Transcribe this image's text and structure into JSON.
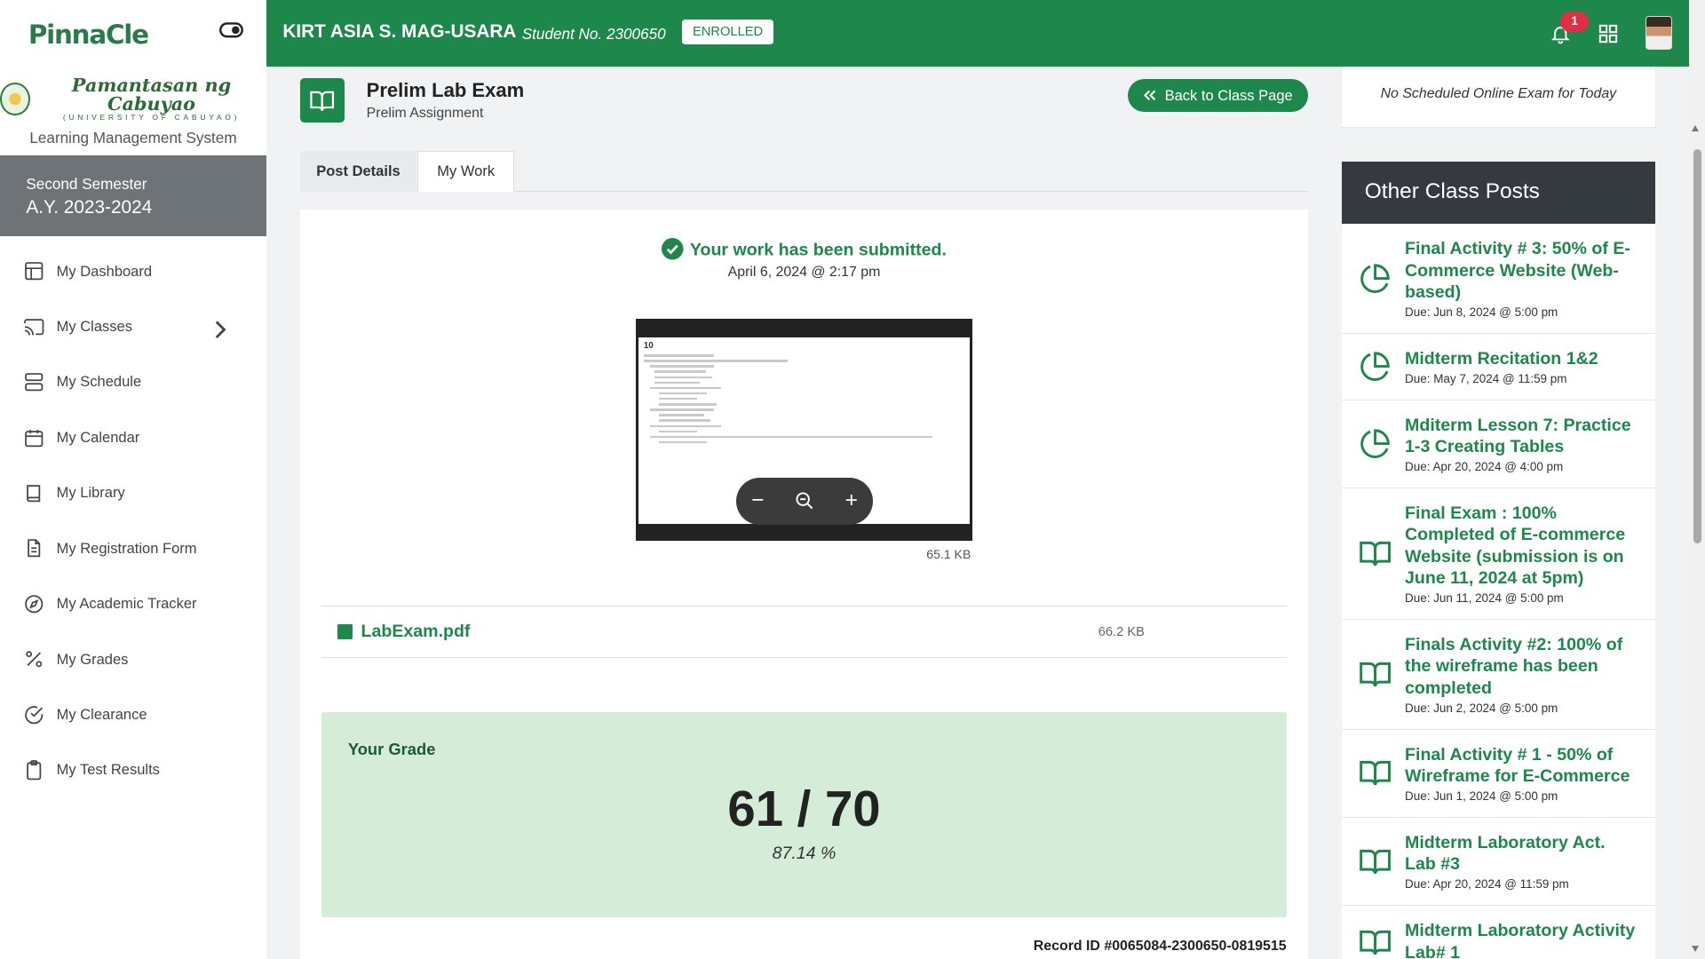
{
  "brand": {
    "logo": "PinnaCle",
    "university_name": "Pamantasan ng Cabuyao",
    "university_sub": "(UNIVERSITY OF CABUYAO)",
    "system_name": "Learning Management System"
  },
  "semester": {
    "term": "Second Semester",
    "year": "A.Y. 2023-2024"
  },
  "nav": [
    {
      "label": "My Dashboard",
      "icon": "dashboard-icon"
    },
    {
      "label": "My Classes",
      "icon": "cast-icon"
    },
    {
      "label": "My Schedule",
      "icon": "server-icon"
    },
    {
      "label": "My Calendar",
      "icon": "calendar-icon"
    },
    {
      "label": "My Library",
      "icon": "book-icon"
    },
    {
      "label": "My Registration Form",
      "icon": "document-icon"
    },
    {
      "label": "My Academic Tracker",
      "icon": "compass-icon"
    },
    {
      "label": "My Grades",
      "icon": "percent-icon"
    },
    {
      "label": "My Clearance",
      "icon": "check-circle-icon"
    },
    {
      "label": "My Test Results",
      "icon": "clipboard-icon"
    }
  ],
  "topbar": {
    "student_name": "KIRT ASIA S. MAG-USARA",
    "student_no": "Student No. 2300650",
    "status": "ENROLLED",
    "notification_count": "1"
  },
  "post": {
    "title": "Prelim Lab Exam",
    "subtitle": "Prelim Assignment",
    "back_label": "Back to Class Page"
  },
  "tabs": [
    "Post Details",
    "My Work"
  ],
  "submission": {
    "message": "Your work has been submitted.",
    "date": "April 6, 2024 @ 2:17 pm",
    "preview_size": "65.1 KB",
    "preview_page_number": "10",
    "file_name": "LabExam.pdf",
    "file_size": "66.2 KB"
  },
  "grade": {
    "label": "Your Grade",
    "score": "61 / 70",
    "percent": "87.14 %",
    "record_id": "Record ID #0065084-2300650-0819515"
  },
  "right": {
    "no_exam": "No Scheduled Online Exam for Today",
    "other_posts_title": "Other Class Posts",
    "posts": [
      {
        "title": "Final Activity # 3: 50% of E-Commerce Website (Web-based)",
        "due": "Due: Jun 8, 2024 @ 5:00 pm",
        "icon": "pie-chart-icon"
      },
      {
        "title": "Midterm Recitation 1&2",
        "due": "Due: May 7, 2024 @ 11:59 pm",
        "icon": "pie-chart-icon"
      },
      {
        "title": "Mditerm Lesson 7: Practice 1-3 Creating Tables",
        "due": "Due: Apr 20, 2024 @ 4:00 pm",
        "icon": "pie-chart-icon"
      },
      {
        "title": "Final Exam : 100% Completed of E-commerce Website (submission is on June 11, 2024 at 5pm)",
        "due": "Due: Jun 11, 2024 @ 5:00 pm",
        "icon": "book-open-icon"
      },
      {
        "title": "Finals Activity #2: 100% of the wireframe has been completed",
        "due": "Due: Jun 2, 2024 @ 5:00 pm",
        "icon": "book-open-icon"
      },
      {
        "title": "Final Activity # 1 - 50% of Wireframe for E-Commerce",
        "due": "Due: Jun 1, 2024 @ 5:00 pm",
        "icon": "book-open-icon"
      },
      {
        "title": "Midterm Laboratory Act. Lab #3",
        "due": "Due: Apr 20, 2024 @ 11:59 pm",
        "icon": "book-open-icon"
      },
      {
        "title": "Midterm Laboratory Activity Lab# 1",
        "due": "",
        "icon": "book-open-icon"
      }
    ]
  },
  "colors": {
    "primary": "#1e874c",
    "sidebar_semester": "#6e7378",
    "grade_bg": "#d5ecd9",
    "panel_head": "#343a40"
  }
}
